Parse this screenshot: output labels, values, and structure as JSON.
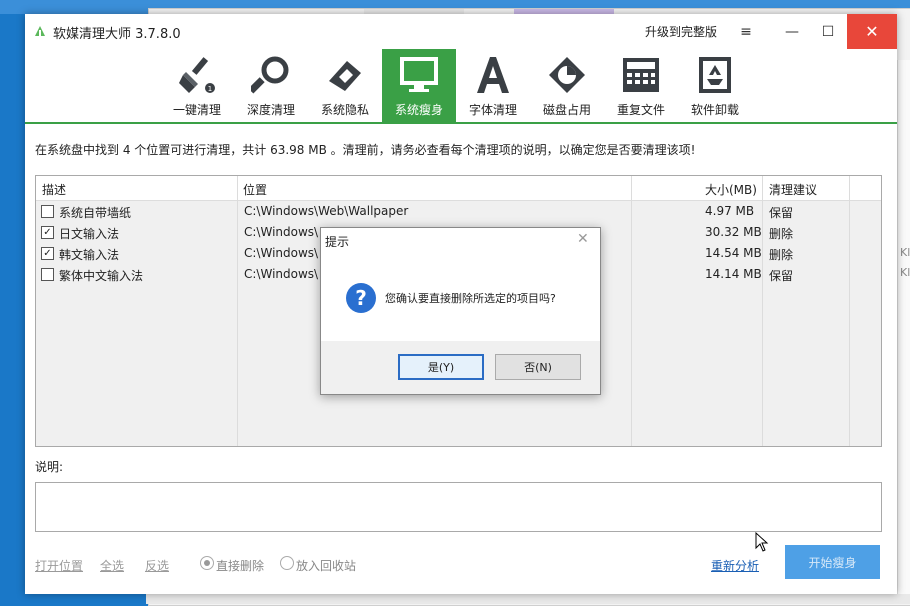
{
  "bg": {
    "side_text": "Kl"
  },
  "app": {
    "title": "软媒清理大师 3.7.8.0",
    "upgrade_label": "升级到完整版",
    "menu_icon": "≡",
    "minimize_icon": "—",
    "maximize_icon": "☐",
    "close_icon": "✕"
  },
  "toolbar": {
    "items": [
      {
        "label": "一键清理",
        "icon": "broom-icon"
      },
      {
        "label": "深度清理",
        "icon": "magnifier-icon"
      },
      {
        "label": "系统隐私",
        "icon": "eraser-icon"
      },
      {
        "label": "系统瘦身",
        "icon": "monitor-icon",
        "active": true
      },
      {
        "label": "字体清理",
        "icon": "font-icon"
      },
      {
        "label": "磁盘占用",
        "icon": "disk-icon"
      },
      {
        "label": "重复文件",
        "icon": "calculator-icon"
      },
      {
        "label": "软件卸载",
        "icon": "recycle-icon"
      }
    ],
    "accent_color": "#3aa046"
  },
  "info_text": "在系统盘中找到 4 个位置可进行清理，共计 63.98 MB 。清理前，请务必查看每个清理项的说明，以确定您是否要清理该项!",
  "table": {
    "headers": {
      "desc": "描述",
      "location": "位置",
      "size": "大小(MB)",
      "advice": "清理建议"
    },
    "rows": [
      {
        "checked": false,
        "desc": "系统自带墙纸",
        "location": "C:\\Windows\\Web\\Wallpaper",
        "size": "4.97 MB",
        "advice": "保留"
      },
      {
        "checked": true,
        "desc": "日文输入法",
        "location": "C:\\Windows\\",
        "size": "30.32 MB",
        "advice": "删除"
      },
      {
        "checked": true,
        "desc": "韩文输入法",
        "location": "C:\\Windows\\",
        "size": "14.54 MB",
        "advice": "删除"
      },
      {
        "checked": false,
        "desc": "繁体中文输入法",
        "location": "C:\\Windows\\",
        "size": "14.14 MB",
        "advice": "保留"
      }
    ]
  },
  "desc_label": "说明:",
  "bottom": {
    "open_location": "打开位置",
    "select_all": "全选",
    "invert": "反选",
    "direct_delete": "直接删除",
    "recycle_bin": "放入回收站",
    "reanalyze": "重新分析",
    "start": "开始瘦身"
  },
  "dialog": {
    "title": "提示",
    "close_icon": "✕",
    "icon_glyph": "?",
    "message": "您确认要直接删除所选定的项目吗?",
    "yes": "是(Y)",
    "no": "否(N)"
  }
}
